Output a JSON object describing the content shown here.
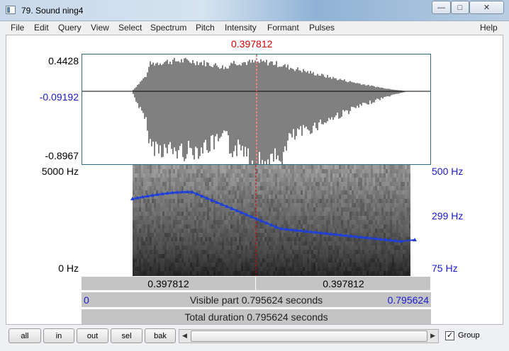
{
  "window": {
    "title": "79. Sound ning4",
    "minimize_icon": "minimize-icon",
    "maximize_icon": "maximize-icon",
    "close_icon": "close-icon"
  },
  "menu": [
    "File",
    "Edit",
    "Query",
    "View",
    "Select",
    "Spectrum",
    "Pitch",
    "Intensity",
    "Formant",
    "Pulses"
  ],
  "menu_help": "Help",
  "cursor": {
    "time_label": "0.397812",
    "time_fraction": 0.5
  },
  "waveform": {
    "max_label": "0.4428",
    "value_label": "-0.09192",
    "min_label": "-0.8967"
  },
  "spectrogram": {
    "top_label": "5000 Hz",
    "bottom_label": "0 Hz",
    "pitch_top_label": "500 Hz",
    "pitch_mid_label": "299 Hz",
    "pitch_bottom_label": "75 Hz"
  },
  "time_rows": {
    "left_cursor": "0.397812",
    "right_cursor": "0.397812",
    "visible_start": "0",
    "visible_text": "Visible part 0.795624 seconds",
    "visible_end": "0.795624",
    "total_text": "Total duration 0.795624 seconds"
  },
  "buttons": {
    "all": "all",
    "in": "in",
    "out": "out",
    "sel": "sel",
    "bak": "bak"
  },
  "group": {
    "label": "Group",
    "checked": true
  },
  "colors": {
    "cursor": "#d40000",
    "pitch": "#1f3fd8",
    "blue_text": "#1a1ad0"
  }
}
